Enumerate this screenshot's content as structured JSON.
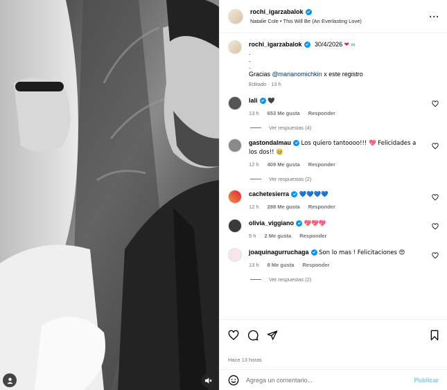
{
  "post": {
    "author": "rochi_igarzabalok",
    "music": "Natalie Cole • This Will Be (An Everlasting Love)",
    "caption": {
      "date_text": "30/4/2026",
      "dots": [
        ".",
        ".",
        "."
      ],
      "line_prefix": "Gracias ",
      "mention": "@marianomichkin",
      "line_suffix": " x este registro",
      "edited": "Editado",
      "time": "13 h"
    }
  },
  "comments": [
    {
      "user": "lali",
      "text": "🖤",
      "time": "13 h",
      "likes": "653 Me gusta",
      "reply": "Responder",
      "replies": "Ver respuestas (4)"
    },
    {
      "user": "gastondalmau",
      "text": "Los quiero tantoooo!!! 💖 Felicidades a los dos!! 🥹",
      "time": "12 h",
      "likes": "409 Me gusta",
      "reply": "Responder",
      "replies": "Ver respuestas (2)"
    },
    {
      "user": "cachetesierra",
      "text": "💙💙💙💙",
      "time": "12 h",
      "likes": "288 Me gusta",
      "reply": "Responder",
      "replies": ""
    },
    {
      "user": "olivia_viggiano",
      "text": "💖💖💖",
      "time": "9 h",
      "likes": "2 Me gusta",
      "reply": "Responder",
      "replies": ""
    },
    {
      "user": "joaquinagurruchaga",
      "text": "Son lo mas ! Felicitaciones 😍",
      "time": "13 h",
      "likes": "8 Me gusta",
      "reply": "Responder",
      "replies": "Ver respuestas (2)"
    }
  ],
  "footer": {
    "time_ago": "Hace 13 horas",
    "comment_placeholder": "Agrega un comentario...",
    "publish_label": "Publicar"
  },
  "icons": {
    "verified": "verified-badge-icon",
    "more": "more-options-icon",
    "like": "heart-icon",
    "comment": "comment-icon",
    "share": "share-icon",
    "save": "bookmark-icon",
    "emoji": "emoji-icon",
    "tag": "user-tag-icon",
    "audio": "audio-muted-icon"
  },
  "colors": {
    "accent": "#0095f6",
    "mention": "#00376b",
    "secondary_text": "#737373",
    "heart": "#e0245e"
  }
}
